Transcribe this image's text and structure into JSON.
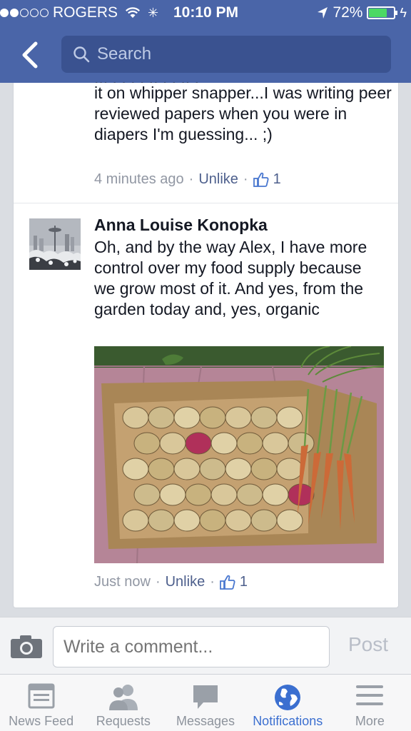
{
  "status_bar": {
    "carrier": "ROGERS",
    "time": "10:10 PM",
    "battery_percent": "72%",
    "battery_level": 0.72,
    "signal_bars_filled": 2,
    "signal_bars_total": 5
  },
  "header": {
    "search_placeholder": "Search",
    "color": "#4a65a8"
  },
  "comments": [
    {
      "text_partial_top": "... . . . . .. . . .. .",
      "text": "it on whipper snapper...I was writing peer reviewed papers when you were in diapers I'm guessing... ;)",
      "time": "4 minutes ago",
      "action": "Unlike",
      "likes": "1"
    },
    {
      "author": "Anna Louise Konopka",
      "text": "Oh, and by the way Alex, I have more control over my food supply because we grow most of it. And yes, from the garden today and, yes, organic",
      "time": "Just now",
      "action": "Unlike",
      "likes": "1"
    }
  ],
  "comment_bar": {
    "placeholder": "Write a comment...",
    "post_label": "Post"
  },
  "tabs": [
    {
      "label": "News Feed",
      "icon": "news-feed-icon",
      "active": false
    },
    {
      "label": "Requests",
      "icon": "requests-icon",
      "active": false
    },
    {
      "label": "Messages",
      "icon": "messages-icon",
      "active": false
    },
    {
      "label": "Notifications",
      "icon": "globe-icon",
      "active": true
    },
    {
      "label": "More",
      "icon": "menu-icon",
      "active": false
    }
  ],
  "colors": {
    "link": "#4d5f8c",
    "active_tab": "#3b6fd0",
    "meta": "#9197a3"
  }
}
